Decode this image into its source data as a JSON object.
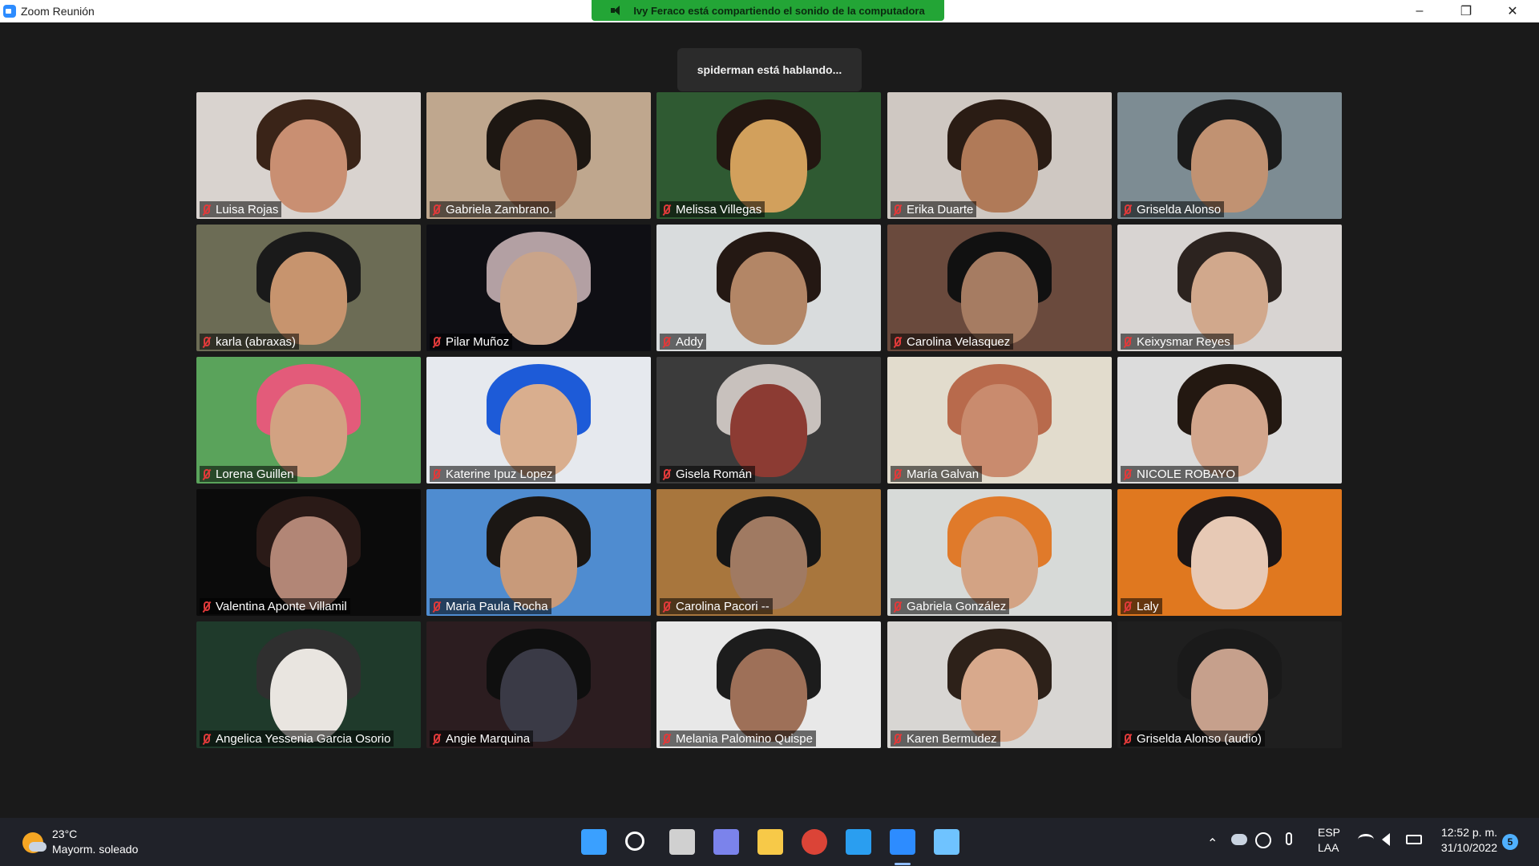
{
  "window": {
    "title": "Zoom Reunión"
  },
  "banner": {
    "text": "Ivy Feraco está compartiendo el sonido de la computadora"
  },
  "speaking": {
    "text": "spiderman está hablando..."
  },
  "window_controls": {
    "minimize": "–",
    "restore": "❐",
    "close": "✕"
  },
  "participants": [
    {
      "name": "Luisa Rojas",
      "muted": true,
      "bg": "#d9d3cf",
      "face": "#c98f72",
      "hair": "#3a2418"
    },
    {
      "name": "Gabriela Zambrano.",
      "muted": true,
      "bg": "#bfa78e",
      "face": "#a87a5e",
      "hair": "#1d1712"
    },
    {
      "name": "Melissa Villegas",
      "muted": true,
      "bg": "#2f5a32",
      "face": "#d2a05c",
      "hair": "#231711"
    },
    {
      "name": "Erika Duarte",
      "muted": true,
      "bg": "#cfc8c2",
      "face": "#b07a58",
      "hair": "#2a1c14"
    },
    {
      "name": "Griselda Alonso",
      "muted": true,
      "bg": "#7d8c93",
      "face": "#c19272",
      "hair": "#1b1b1b"
    },
    {
      "name": "karla (abraxas)",
      "muted": true,
      "bg": "#6c6c55",
      "face": "#c7946e",
      "hair": "#1a1a1a"
    },
    {
      "name": "Pilar Muñoz",
      "muted": true,
      "bg": "#0f0f14",
      "face": "#c9a48a",
      "hair": "#b3a0a3"
    },
    {
      "name": "Addy",
      "muted": true,
      "bg": "#d9dcdd",
      "face": "#b38666",
      "hair": "#241813"
    },
    {
      "name": "Carolina Velasquez",
      "muted": true,
      "bg": "#6a4a3d",
      "face": "#a67c62",
      "hair": "#111111"
    },
    {
      "name": "Keixysmar Reyes",
      "muted": true,
      "bg": "#d8d4d2",
      "face": "#d1a88c",
      "hair": "#2c231f"
    },
    {
      "name": "Lorena Guillen",
      "muted": true,
      "bg": "#5aa35b",
      "face": "#d2a282",
      "hair": "#e35b7a"
    },
    {
      "name": "Katerine Ipuz Lopez",
      "muted": true,
      "bg": "#e6e9ee",
      "face": "#d9ae8e",
      "hair": "#1d5bd8"
    },
    {
      "name": "Gisela Román",
      "muted": true,
      "bg": "#3b3b3b",
      "face": "#8c3b33",
      "hair": "#c8c1bd"
    },
    {
      "name": "María Galvan",
      "muted": true,
      "bg": "#e2dccd",
      "face": "#c98b6e",
      "hair": "#b86a4c"
    },
    {
      "name": "NICOLE ROBAYO",
      "muted": true,
      "bg": "#dcdcdc",
      "face": "#d3a68c",
      "hair": "#231811"
    },
    {
      "name": "Valentina Aponte Villamil",
      "muted": true,
      "bg": "#0b0b0b",
      "face": "#b28676",
      "hair": "#2a1a17"
    },
    {
      "name": "Maria Paula Rocha",
      "muted": true,
      "bg": "#4f8cd0",
      "face": "#c89a7a",
      "hair": "#1b1714"
    },
    {
      "name": "Carolina Pacori --",
      "muted": true,
      "bg": "#a8763d",
      "face": "#a07a62",
      "hair": "#161616"
    },
    {
      "name": "Gabriela González",
      "muted": true,
      "bg": "#d7dad8",
      "face": "#d3a384",
      "hair": "#e07a2a"
    },
    {
      "name": "Laly",
      "muted": true,
      "bg": "#e0781f",
      "face": "#e7c9b5",
      "hair": "#1c1616"
    },
    {
      "name": "Angelica Yessenia Garcia Osorio",
      "muted": true,
      "bg": "#1f3a2b",
      "face": "#e9e5e0",
      "hair": "#2f2f2f"
    },
    {
      "name": "Angie Marquina",
      "muted": true,
      "bg": "#2c1d20",
      "face": "#3a3a46",
      "hair": "#0f0f0f"
    },
    {
      "name": "Melania Palomino Quispe",
      "muted": true,
      "bg": "#e8e8e8",
      "face": "#9e7058",
      "hair": "#1c1c1c"
    },
    {
      "name": "Karen Bermudez",
      "muted": true,
      "bg": "#d8d6d3",
      "face": "#d8a98c",
      "hair": "#2d2119"
    },
    {
      "name": "Griselda Alonso (audio)",
      "muted": true,
      "bg": "#1f1f1f",
      "face": "#c6a08c",
      "hair": "#1a1a1a"
    }
  ],
  "taskbar": {
    "weather_temp": "23°C",
    "weather_desc": "Mayorm. soleado",
    "apps": [
      {
        "name": "windows-start-icon",
        "color": "#3aa0ff"
      },
      {
        "name": "search-icon",
        "color": "#ffffff"
      },
      {
        "name": "task-view-icon",
        "color": "#d0d0d0"
      },
      {
        "name": "teams-chat-icon",
        "color": "#7b83eb"
      },
      {
        "name": "file-explorer-icon",
        "color": "#f7c948"
      },
      {
        "name": "chrome-icon",
        "color": "#db4437"
      },
      {
        "name": "vscode-icon",
        "color": "#2a9ef0"
      },
      {
        "name": "zoom-icon",
        "color": "#2d8cff"
      },
      {
        "name": "paint-icon",
        "color": "#6fc3ff"
      }
    ],
    "lang_top": "ESP",
    "lang_bottom": "LAA",
    "time": "12:52 p. m.",
    "date": "31/10/2022",
    "notifications": "5"
  }
}
